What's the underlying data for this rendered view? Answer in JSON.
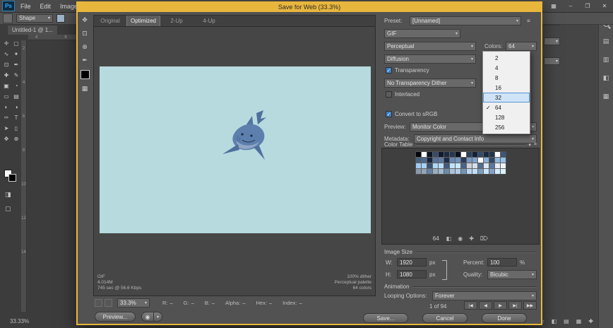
{
  "icons": {
    "arrow_down": "▾",
    "menu": "≡",
    "eye": "◉",
    "check": "✓"
  },
  "theme": {
    "accent_gold": "#e9b63d",
    "canvas_blue": "#b6dade",
    "highlight_blue": "#5694d6"
  },
  "app": {
    "logo_text": "Ps",
    "menus": [
      "File",
      "Edit",
      "Image"
    ],
    "doc_tab": "Untitled-1 @ 1...",
    "options_tool_label": "Shape",
    "status_zoom": "33.33%",
    "window_controls": {
      "minimize": "–",
      "maximize": "❐",
      "close": "✕"
    },
    "ruler_h": [
      "4",
      "6"
    ],
    "ruler_v": [
      "2",
      "4",
      "6",
      "8",
      "10",
      "12",
      "14"
    ],
    "toolbar_tools": [
      {
        "name": "move-tool",
        "glyph": "✛"
      },
      {
        "name": "marquee-tool",
        "glyph": "▢"
      },
      {
        "name": "lasso-tool",
        "glyph": "∿"
      },
      {
        "name": "quick-selection-tool",
        "glyph": "✦"
      },
      {
        "name": "crop-tool",
        "glyph": "⊡"
      },
      {
        "name": "eyedropper-tool",
        "glyph": "✒"
      },
      {
        "name": "healing-brush-tool",
        "glyph": "✚"
      },
      {
        "name": "brush-tool",
        "glyph": "✎"
      },
      {
        "name": "clone-stamp-tool",
        "glyph": "▣"
      },
      {
        "name": "history-brush-tool",
        "glyph": "◔"
      },
      {
        "name": "eraser-tool",
        "glyph": "▭"
      },
      {
        "name": "gradient-tool",
        "glyph": "▤"
      },
      {
        "name": "blur-tool",
        "glyph": "◐"
      },
      {
        "name": "dodge-tool",
        "glyph": "◑"
      },
      {
        "name": "pen-tool",
        "glyph": "✑"
      },
      {
        "name": "type-tool",
        "glyph": "T"
      },
      {
        "name": "path-selection-tool",
        "glyph": "➤"
      },
      {
        "name": "shape-tool",
        "glyph": "▯"
      },
      {
        "name": "hand-tool",
        "glyph": "✥"
      },
      {
        "name": "zoom-tool",
        "glyph": "⊕"
      }
    ],
    "toolbar_extra": [
      {
        "name": "quick-mask-icon",
        "glyph": "◨"
      },
      {
        "name": "screen-mode-icon",
        "glyph": "▢"
      }
    ],
    "right_dock_icons": [
      {
        "name": "color-panel-icon",
        "glyph": "▤"
      },
      {
        "name": "libraries-panel-icon",
        "glyph": "▥"
      },
      {
        "name": "adjustments-panel-icon",
        "glyph": "◧"
      },
      {
        "name": "layers-panel-icon",
        "glyph": "▦"
      }
    ],
    "bottom_dock_icons": [
      {
        "name": "folder-icon",
        "glyph": "▱"
      },
      {
        "name": "adjustments-icon",
        "glyph": "◧"
      },
      {
        "name": "layers-icon",
        "glyph": "▤"
      },
      {
        "name": "channels-icon",
        "glyph": "▦"
      },
      {
        "name": "add-icon",
        "glyph": "✚"
      }
    ]
  },
  "dialog": {
    "title": "Save for Web (33.3%)",
    "slice_toggle_glyph": "▦",
    "tools": [
      {
        "name": "hand-tool",
        "glyph": "✥"
      },
      {
        "name": "slice-select-tool",
        "glyph": "⊡"
      },
      {
        "name": "zoom-tool",
        "glyph": "⊕"
      },
      {
        "name": "eyedropper-tool",
        "glyph": "✒"
      }
    ],
    "tabs": [
      {
        "label": "Original"
      },
      {
        "label": "Optimized"
      },
      {
        "label": "2-Up"
      },
      {
        "label": "4-Up"
      }
    ],
    "preview_info": {
      "format": "GIF",
      "file_size": "4.014M",
      "download_time": "745 sec @ 56.6 Kbps",
      "dither": "100% dither",
      "palette": "Perceptual palette",
      "colors": "64 colors"
    },
    "statusbar": {
      "zoom": "33.3%",
      "fields": [
        {
          "label": "R:",
          "value": "–"
        },
        {
          "label": "G:",
          "value": "–"
        },
        {
          "label": "B:",
          "value": "–"
        },
        {
          "label": "Alpha:",
          "value": "–"
        },
        {
          "label": "Hex:",
          "value": "–"
        },
        {
          "label": "Index:",
          "value": "–"
        }
      ]
    },
    "footer": {
      "preview_button": "Preview...",
      "save_button": "Save...",
      "cancel_button": "Cancel",
      "done_button": "Done"
    },
    "settings": {
      "preset_label": "Preset:",
      "preset_value": "[Unnamed]",
      "format_value": "GIF",
      "palette_value": "Perceptual",
      "colors_label": "Colors:",
      "colors_value": "64",
      "dither_method_value": "Diffusion",
      "transparency_label": "Transparency",
      "transparency_dither_value": "No Transparency Dither",
      "interlaced_label": "Interlaced",
      "convert_srgb_label": "Convert to sRGB",
      "preview_label": "Preview:",
      "preview_value": "Monitor Color",
      "metadata_label": "Metadata:",
      "metadata_value": "Copyright and Contact Info"
    },
    "colors_dropdown": {
      "options": [
        "2",
        "4",
        "8",
        "16",
        "32",
        "64",
        "128",
        "256"
      ],
      "selected": "64",
      "highlighted": "32"
    },
    "color_table": {
      "title": "Color Table",
      "count": "64",
      "icons": [
        {
          "name": "snap-web-palette-icon",
          "glyph": "◧"
        },
        {
          "name": "lock-color-icon",
          "glyph": "◉"
        },
        {
          "name": "add-color-icon",
          "glyph": "✚"
        },
        {
          "name": "delete-color-icon",
          "glyph": "⌦"
        }
      ],
      "swatches": [
        "#05070c",
        "#ffffff",
        "#0d1422",
        "#394a66",
        "#101a2c",
        "#1d2a40",
        "#26374f",
        "#0a101c",
        "#ffffff",
        "#2e4058",
        "#13203a",
        "#364a68",
        "#1a2840",
        "#223448",
        "#ffffff",
        "#3e5478",
        "#46607f",
        "#4e6a8c",
        "#16223a",
        "#57719a",
        "#5f7ba4",
        "#1e2c48",
        "#6785ae",
        "#6f8fb8",
        "#2b3c58",
        "#7799c2",
        "#7fa3cc",
        "#ffffff",
        "#87add6",
        "#334764",
        "#8fb7e0",
        "#97c1ea",
        "#9fcbf2",
        "#a7d1f4",
        "#3b516f",
        "#afd7f6",
        "#b7ddf8",
        "#43597b",
        "#bfe3fa",
        "#c7e9fc",
        "#4b6387",
        "#ced2d8",
        "#d6dfe8",
        "#536d93",
        "#dee7f0",
        "#5b779f",
        "#e6edf4",
        "#eef3f8",
        "#8a9aaa",
        "#92a4b6",
        "#63819f",
        "#9aaec2",
        "#a2b8ce",
        "#6b8ba9",
        "#aac2da",
        "#b2cce6",
        "#7395b3",
        "#bad6f2",
        "#c2e0fb",
        "#7b9fbd",
        "#cae6fd",
        "#839fc7",
        "#d2ecfe",
        "#d9f1ff"
      ]
    },
    "image_size": {
      "title": "Image Size",
      "w_label": "W:",
      "w_value": "1920",
      "w_unit": "px",
      "h_label": "H:",
      "h_value": "1080",
      "h_unit": "px",
      "percent_label": "Percent:",
      "percent_value": "100",
      "percent_unit": "%",
      "quality_label": "Quality:",
      "quality_value": "Bicubic"
    },
    "animation": {
      "title": "Animation",
      "looping_label": "Looping Options:",
      "looping_value": "Forever",
      "frame_status": "1 of 94",
      "controls": [
        {
          "name": "first-frame-button",
          "glyph": "|◀"
        },
        {
          "name": "previous-frame-button",
          "glyph": "◀"
        },
        {
          "name": "play-button",
          "glyph": "▶"
        },
        {
          "name": "next-frame-button",
          "glyph": "▶|"
        },
        {
          "name": "last-frame-button",
          "glyph": "▶▶"
        }
      ]
    }
  }
}
